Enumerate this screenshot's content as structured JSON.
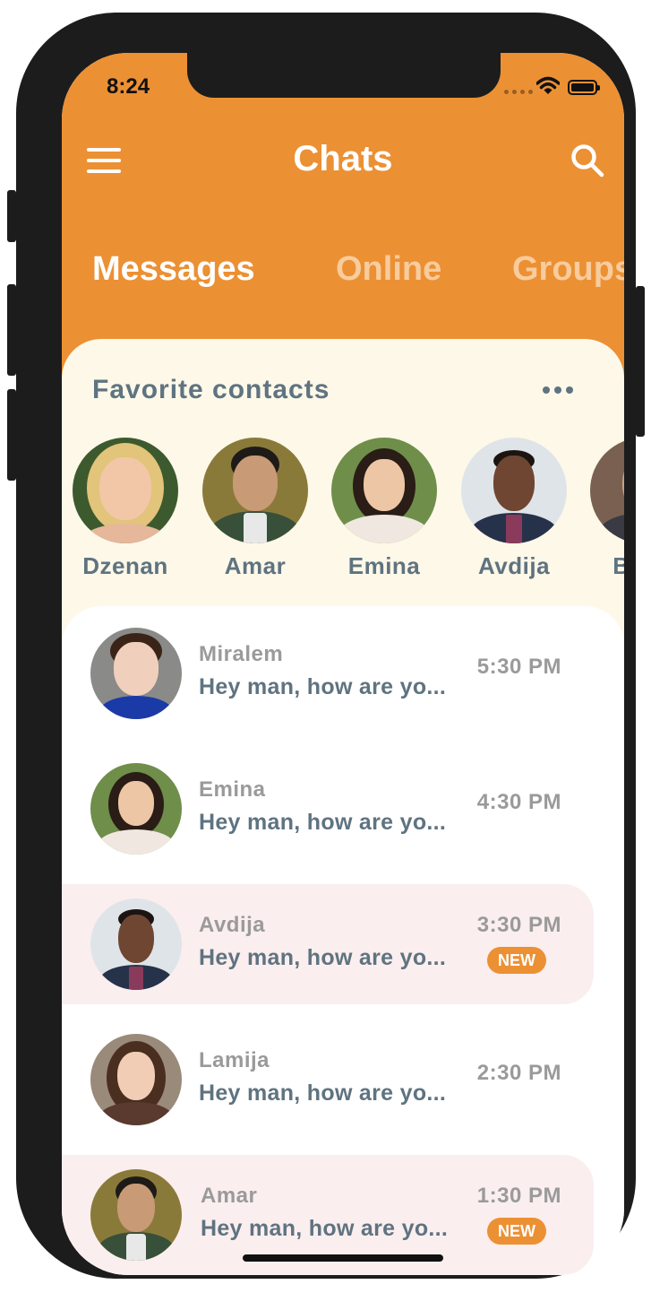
{
  "status_bar": {
    "time": "8:24"
  },
  "header": {
    "title": "Chats"
  },
  "tabs": [
    {
      "label": "Messages",
      "active": true
    },
    {
      "label": "Online",
      "active": false
    },
    {
      "label": "Groups",
      "active": false
    }
  ],
  "favorites": {
    "title": "Favorite contacts",
    "contacts": [
      {
        "name": "Dzenan"
      },
      {
        "name": "Amar"
      },
      {
        "name": "Emina"
      },
      {
        "name": "Avdija"
      },
      {
        "name": "Bakir"
      }
    ]
  },
  "chats": [
    {
      "name": "Miralem",
      "preview": "Hey man, how are yo...",
      "time": "5:30 PM",
      "unread": false
    },
    {
      "name": "Emina",
      "preview": "Hey man, how are yo...",
      "time": "4:30 PM",
      "unread": false
    },
    {
      "name": "Avdija",
      "preview": "Hey man, how are yo...",
      "time": "3:30 PM",
      "unread": true,
      "badge": "NEW"
    },
    {
      "name": "Lamija",
      "preview": "Hey man, how are yo...",
      "time": "2:30 PM",
      "unread": false
    },
    {
      "name": "Amar",
      "preview": "Hey man, how are yo...",
      "time": "1:30 PM",
      "unread": true,
      "badge": "NEW"
    }
  ],
  "colors": {
    "accent": "#ec9034",
    "favorites_bg": "#fdf8e8",
    "unread_bg": "#fbeeee",
    "text_primary": "#5f7380",
    "text_muted": "#9a9a9a"
  },
  "icons": {
    "menu": "menu-icon",
    "search": "search-icon",
    "more": "more-horizontal-icon"
  }
}
